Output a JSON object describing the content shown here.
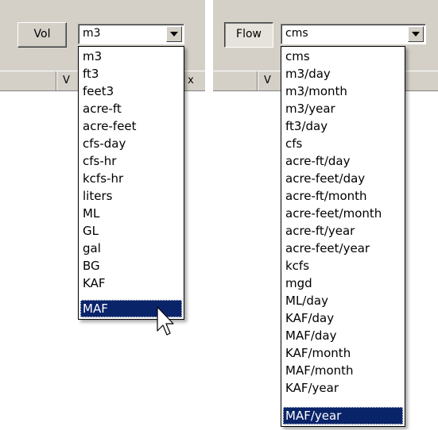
{
  "vol_panel": {
    "button_label": "Vol",
    "combo_value": "m3",
    "tab_fragment_left": "V",
    "tab_fragment_right": "x",
    "options": [
      "m3",
      "ft3",
      "feet3",
      "acre-ft",
      "acre-feet",
      "cfs-day",
      "cfs-hr",
      "kcfs-hr",
      "liters",
      "ML",
      "GL",
      "gal",
      "BG",
      "KAF",
      "MAF"
    ],
    "selected": "MAF"
  },
  "flow_panel": {
    "button_label": "Flow",
    "combo_value": "cms",
    "tab_fragment_left": "V",
    "options": [
      "cms",
      "m3/day",
      "m3/month",
      "m3/year",
      "ft3/day",
      "cfs",
      "acre-ft/day",
      "acre-feet/day",
      "acre-ft/month",
      "acre-feet/month",
      "acre-ft/year",
      "acre-feet/year",
      "kcfs",
      "mgd",
      "ML/day",
      "KAF/day",
      "MAF/day",
      "KAF/month",
      "MAF/month",
      "KAF/year",
      "MAF/year"
    ],
    "selected": "MAF/year"
  },
  "colors": {
    "panel": "#d4d0c8",
    "selection": "#0a246a"
  },
  "icons": {
    "cursor": "arrow-pointer-icon",
    "dropdown": "chevron-down-icon"
  }
}
